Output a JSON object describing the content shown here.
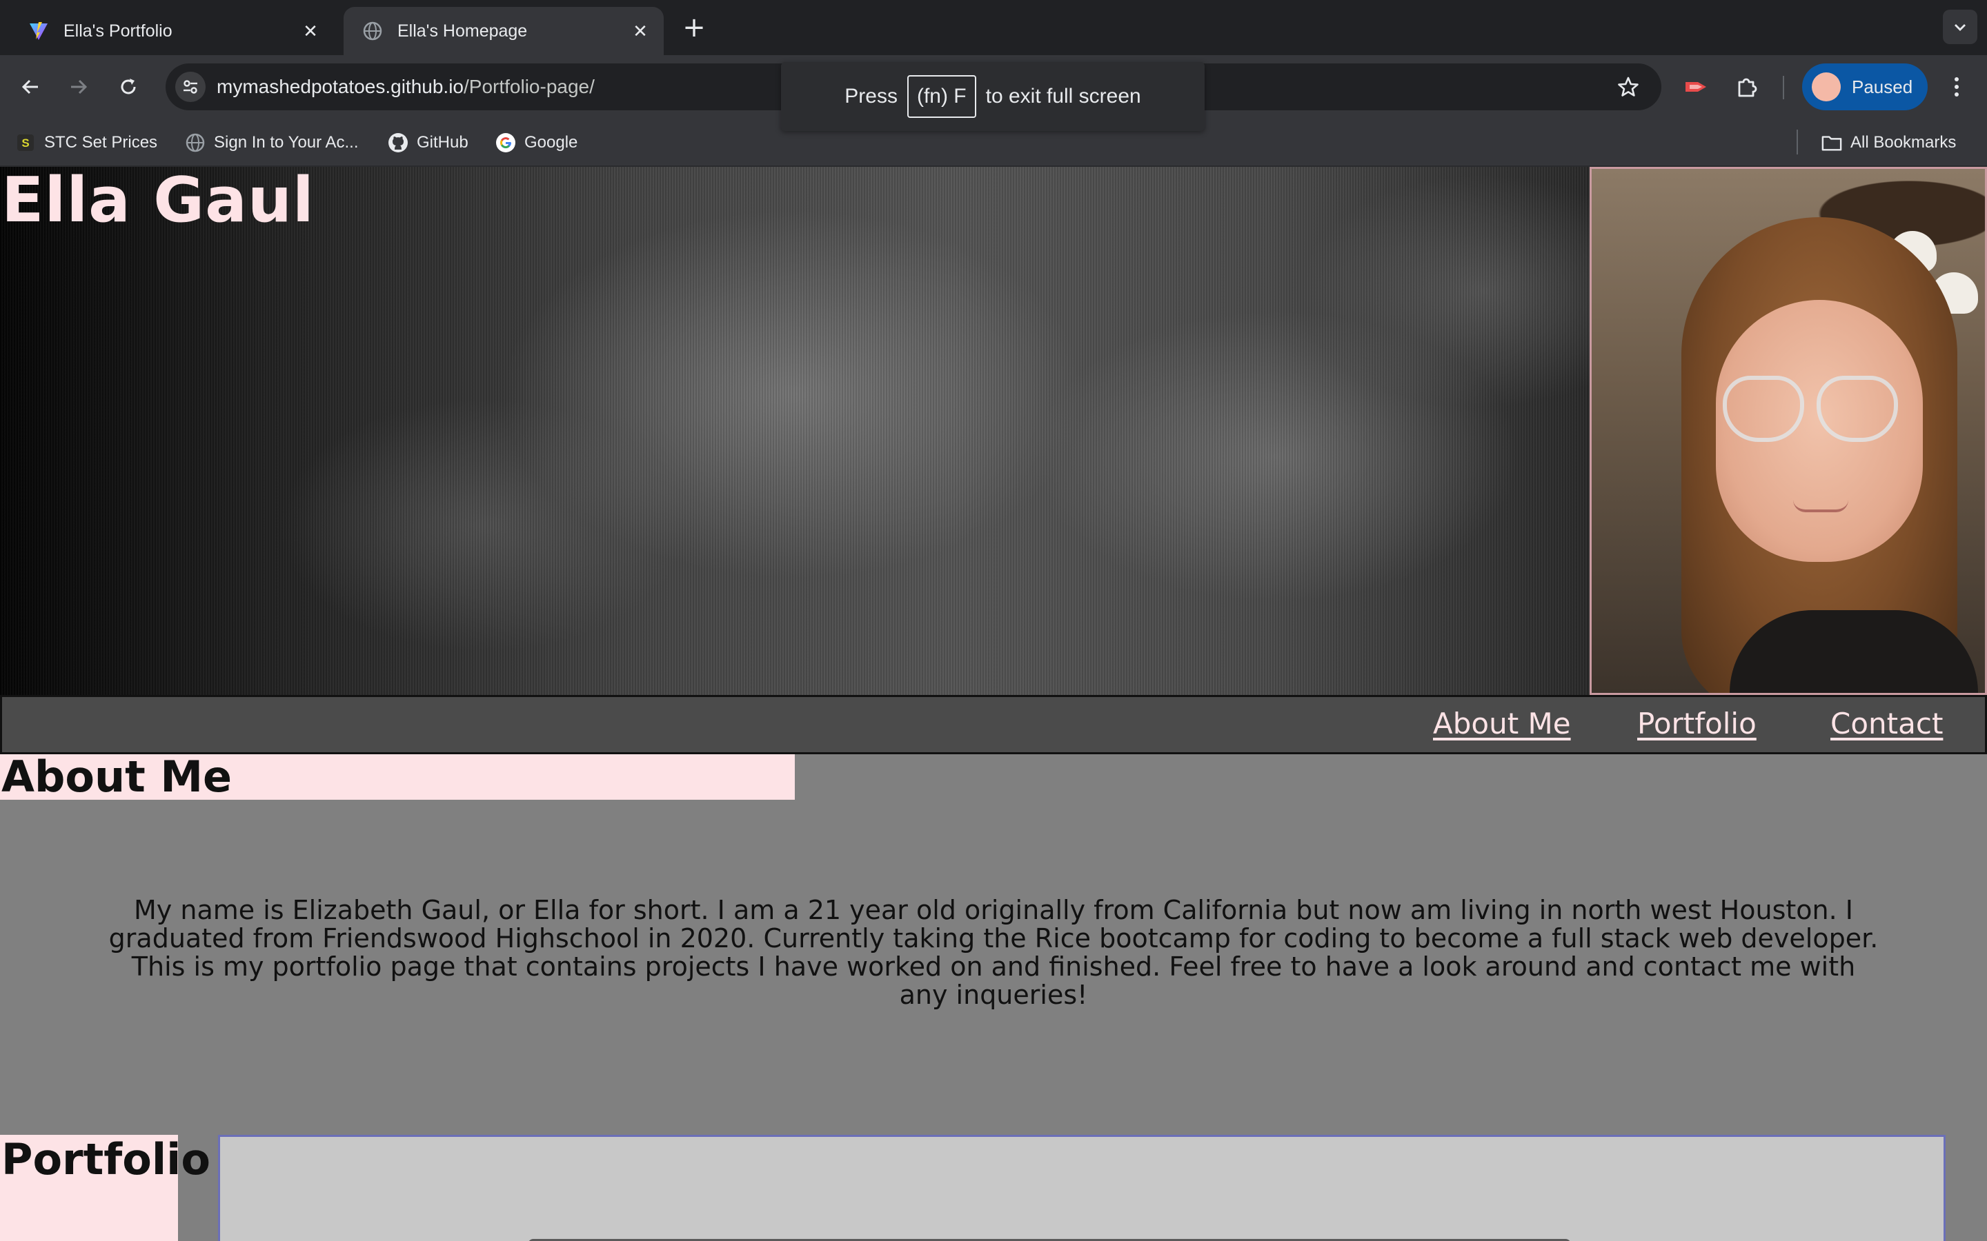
{
  "browser": {
    "tabs": [
      {
        "title": "Ella's Portfolio",
        "active": false,
        "icon": "vite-logo-icon"
      },
      {
        "title": "Ella's Homepage",
        "active": true,
        "icon": "globe-icon"
      }
    ],
    "url_host": "mymashedpotatoes.github.io",
    "url_path": "/Portfolio-page/",
    "profile_label": "Paused",
    "bookmarks": [
      {
        "label": "STC Set Prices",
        "icon": "s-badge-icon"
      },
      {
        "label": "Sign In to Your Ac...",
        "icon": "globe-icon"
      },
      {
        "label": "GitHub",
        "icon": "github-icon"
      },
      {
        "label": "Google",
        "icon": "google-icon"
      }
    ],
    "all_bookmarks_label": "All Bookmarks",
    "fullscreen_toast": {
      "press": "Press",
      "key": "(fn) F",
      "suffix": "to exit full screen"
    }
  },
  "page": {
    "name": "Ella Gaul",
    "nav": [
      "About Me",
      "Portfolio",
      "Contact"
    ],
    "about": {
      "heading": "About Me",
      "text": "My name is Elizabeth Gaul, or Ella for short. I am a 21 year old originally from California but now am living in north west Houston. I graduated from Friendswood Highschool in 2020. Currently taking the Rice bootcamp for coding to become a full stack web developer. This is my portfolio page that contains projects I have worked on and finished. Feel free to have a look around and contact me with any inqueries!"
    },
    "portfolio": {
      "heading": "Portfolio"
    }
  },
  "colors": {
    "accent_pink": "#fde3e6",
    "page_bg": "#808080",
    "nav_bg": "#4b4b4b",
    "chrome_dark": "#202124",
    "chrome_toolbar": "#35363a",
    "profile_blue": "#0b57a4"
  }
}
